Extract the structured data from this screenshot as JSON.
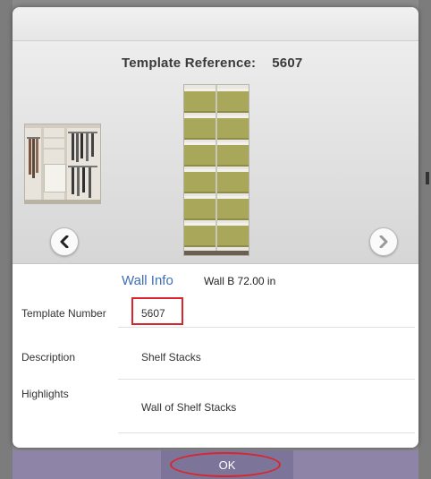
{
  "preview": {
    "template_reference_label": "Template Reference:",
    "template_reference_number": "5607",
    "thumbnail_icon": "closet-thumbnail",
    "stack_icon": "shelf-stack-illustration",
    "prev_icon": "chevron-left-icon",
    "next_icon": "chevron-right-icon",
    "shelf_color": "#a9a75a"
  },
  "info": {
    "title": "Wall Info",
    "wall_description": "Wall B 72.00 in",
    "rows": [
      {
        "label": "Template Number",
        "value": "5607"
      },
      {
        "label": "Description",
        "value": "Shelf Stacks"
      },
      {
        "label": "Highlights",
        "value": "Wall of Shelf Stacks"
      }
    ]
  },
  "footer": {
    "ok_label": "OK"
  },
  "colors": {
    "accent_link": "#3f6fb5",
    "highlight_red": "#d9262a",
    "footer_purple": "#8d84a8"
  }
}
